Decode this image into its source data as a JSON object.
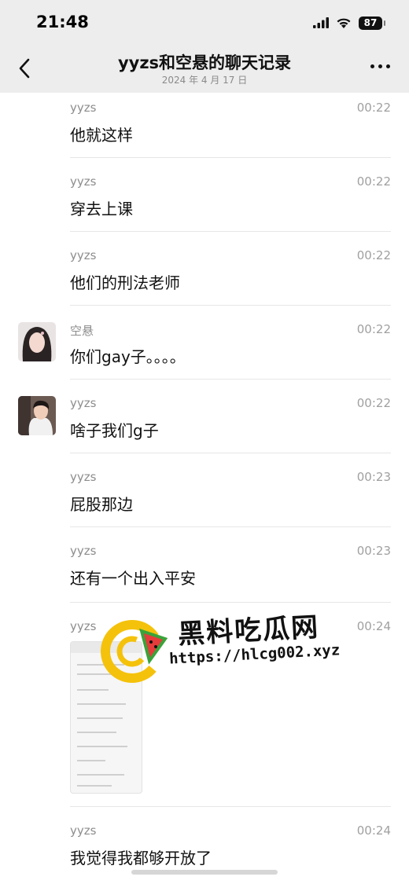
{
  "status_bar": {
    "time": "21:48",
    "battery": "87"
  },
  "nav": {
    "title": "yyzs和空悬的聊天记录",
    "date": "2024 年 4 月 17 日"
  },
  "messages": [
    {
      "sender": "yyzs",
      "time": "00:22",
      "text": "他就这样"
    },
    {
      "sender": "yyzs",
      "time": "00:22",
      "text": "穿去上课"
    },
    {
      "sender": "yyzs",
      "time": "00:22",
      "text": "他们的刑法老师"
    },
    {
      "sender": "空悬",
      "time": "00:22",
      "text": "你们gay子。。。。"
    },
    {
      "sender": "yyzs",
      "time": "00:22",
      "text": "啥子我们g子"
    },
    {
      "sender": "yyzs",
      "time": "00:23",
      "text": "屁股那边"
    },
    {
      "sender": "yyzs",
      "time": "00:23",
      "text": "还有一个出入平安"
    },
    {
      "sender": "yyzs",
      "time": "00:24",
      "text": ""
    },
    {
      "sender": "yyzs",
      "time": "00:24",
      "text": "我觉得我都够开放了"
    }
  ],
  "watermark": {
    "title": "黑料吃瓜网",
    "url": "https://hlcg002.xyz"
  },
  "icons": {
    "back": "back-chevron-icon",
    "more": "more-dots-icon",
    "signal": "signal-icon",
    "wifi": "wifi-icon",
    "battery": "battery-icon"
  }
}
